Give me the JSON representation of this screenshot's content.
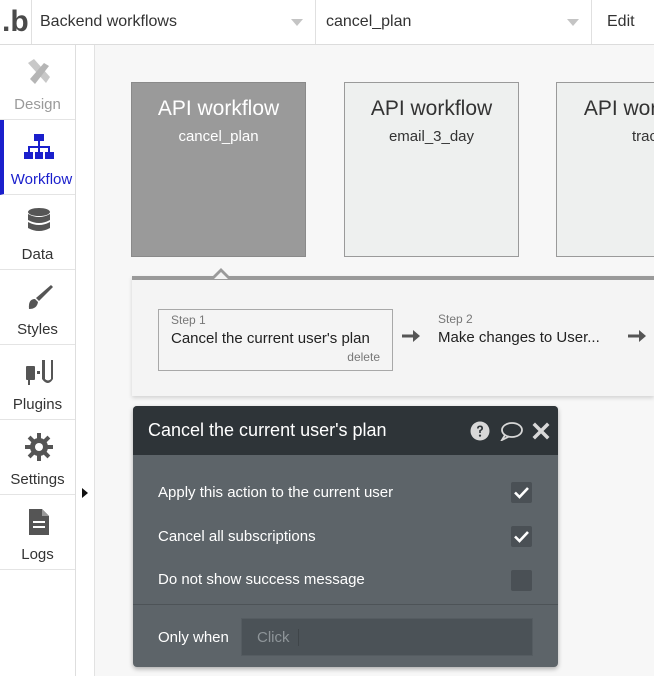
{
  "app": {
    "logo_text": ".b"
  },
  "topbar": {
    "page_select_value": "Backend workflows",
    "workflow_select_value": "cancel_plan",
    "edit_label": "Edit"
  },
  "sidebar": {
    "items": [
      {
        "label": "Design",
        "icon": "design-icon",
        "state": "disabled"
      },
      {
        "label": "Workflow",
        "icon": "workflow-icon",
        "state": "active"
      },
      {
        "label": "Data",
        "icon": "database-icon",
        "state": "normal"
      },
      {
        "label": "Styles",
        "icon": "brush-icon",
        "state": "normal"
      },
      {
        "label": "Plugins",
        "icon": "plug-icon",
        "state": "normal"
      },
      {
        "label": "Settings",
        "icon": "gear-icon",
        "state": "normal"
      },
      {
        "label": "Logs",
        "icon": "document-icon",
        "state": "normal"
      }
    ]
  },
  "workflows": [
    {
      "title": "API workflow",
      "name": "cancel_plan",
      "selected": true
    },
    {
      "title": "API workflow",
      "name": "email_3_day",
      "selected": false
    },
    {
      "title": "API workflow",
      "name": "trac",
      "selected": false
    }
  ],
  "steps": [
    {
      "number": "Step 1",
      "name": "Cancel the current user's plan",
      "delete_label": "delete"
    },
    {
      "number": "Step 2",
      "name": "Make changes to User..."
    }
  ],
  "panel": {
    "title": "Cancel the current user's plan",
    "rows": [
      {
        "label": "Apply this action to the current user",
        "checked": true
      },
      {
        "label": "Cancel all subscriptions",
        "checked": true
      },
      {
        "label": "Do not show success message",
        "checked": false
      }
    ],
    "only_when_label": "Only when",
    "only_when_placeholder": "Click"
  },
  "colors": {
    "accent": "#1a1fcc",
    "panel_bg": "#5d6469",
    "panel_header": "#2e3438",
    "selected_card": "#9a9a9a"
  }
}
